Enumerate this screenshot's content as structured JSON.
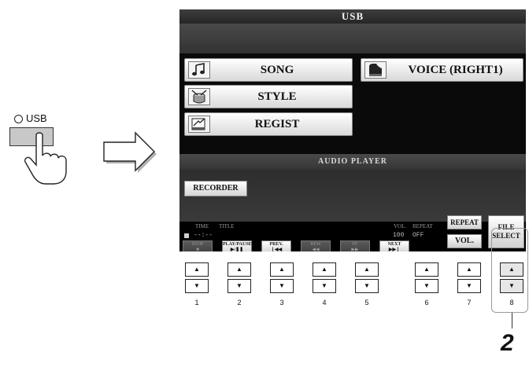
{
  "usb_panel": {
    "label": "USB"
  },
  "screen": {
    "title": "USB",
    "buttons": {
      "song": "SONG",
      "style": "STYLE",
      "regist": "REGIST",
      "voice": "VOICE (RIGHT1)"
    },
    "audio_player_label": "AUDIO PLAYER",
    "recorder": "RECORDER",
    "info_labels": {
      "time": "TIME",
      "title": "TITLE",
      "vol": "VOL.",
      "repeat": "REPEAT"
    },
    "status": {
      "time": "--:--",
      "vol": "100",
      "repeat": "OFF"
    },
    "transport": [
      {
        "label": "STOP",
        "glyph": "■"
      },
      {
        "label": "PLAY/PAUSE",
        "glyph": "▶/❚❚"
      },
      {
        "label": "PREV.",
        "glyph": "❘◀◀"
      },
      {
        "label": "REW",
        "glyph": "◀◀"
      },
      {
        "label": "FF",
        "glyph": "▶▶"
      },
      {
        "label": "NEXT",
        "glyph": "▶▶❘"
      }
    ],
    "repeat_button": "REPEAT",
    "vol_button": "VOL.",
    "file_select_button": [
      "FILE",
      "SELECT"
    ]
  },
  "physical_buttons": {
    "up_glyph": "▲",
    "down_glyph": "▼",
    "numbers": [
      "1",
      "2",
      "3",
      "4",
      "5",
      "6",
      "7",
      "8"
    ]
  },
  "step_number": "2"
}
